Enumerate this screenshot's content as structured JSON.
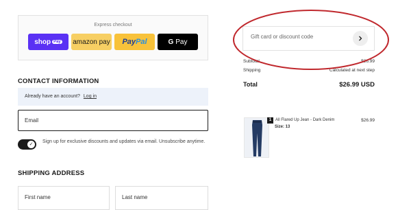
{
  "express": {
    "title": "Express checkout",
    "shop_label": "shop",
    "shop_badge": "Pay",
    "amazon_label": "amazon pay",
    "paypal_pay": "Pay",
    "paypal_pal": "Pal",
    "gpay_g": "G",
    "gpay_label": "Pay"
  },
  "contact": {
    "title": "CONTACT INFORMATION",
    "account_prompt": "Already have an account?",
    "login_link": "Log in",
    "email_placeholder": "Email",
    "signup_text": "Sign up for exclusive discounts and updates via email. Unsubscribe anytime.",
    "signup_checked": true
  },
  "shipping_address": {
    "title": "SHIPPING ADDRESS",
    "first_name_placeholder": "First name",
    "last_name_placeholder": "Last name"
  },
  "discount": {
    "placeholder": "Gift card or discount code",
    "annotation_color": "#c0282d"
  },
  "summary": {
    "subtotal_label": "Subtotal",
    "subtotal_value": "$26.99",
    "shipping_label": "Shipping",
    "shipping_value": "Calculated at next step",
    "total_label": "Total",
    "total_value": "$26.99 USD"
  },
  "product": {
    "quantity": "1",
    "name": "All Flared Up Jean - Dark Denim",
    "size": "Size: 13",
    "price": "$26.99"
  },
  "colors": {
    "shop_pay": "#5a31f4",
    "amazon_pay": "#f7cf63",
    "paypal": "#f8c23a",
    "google_pay": "#000000",
    "contact_banner": "#edf2fa"
  }
}
